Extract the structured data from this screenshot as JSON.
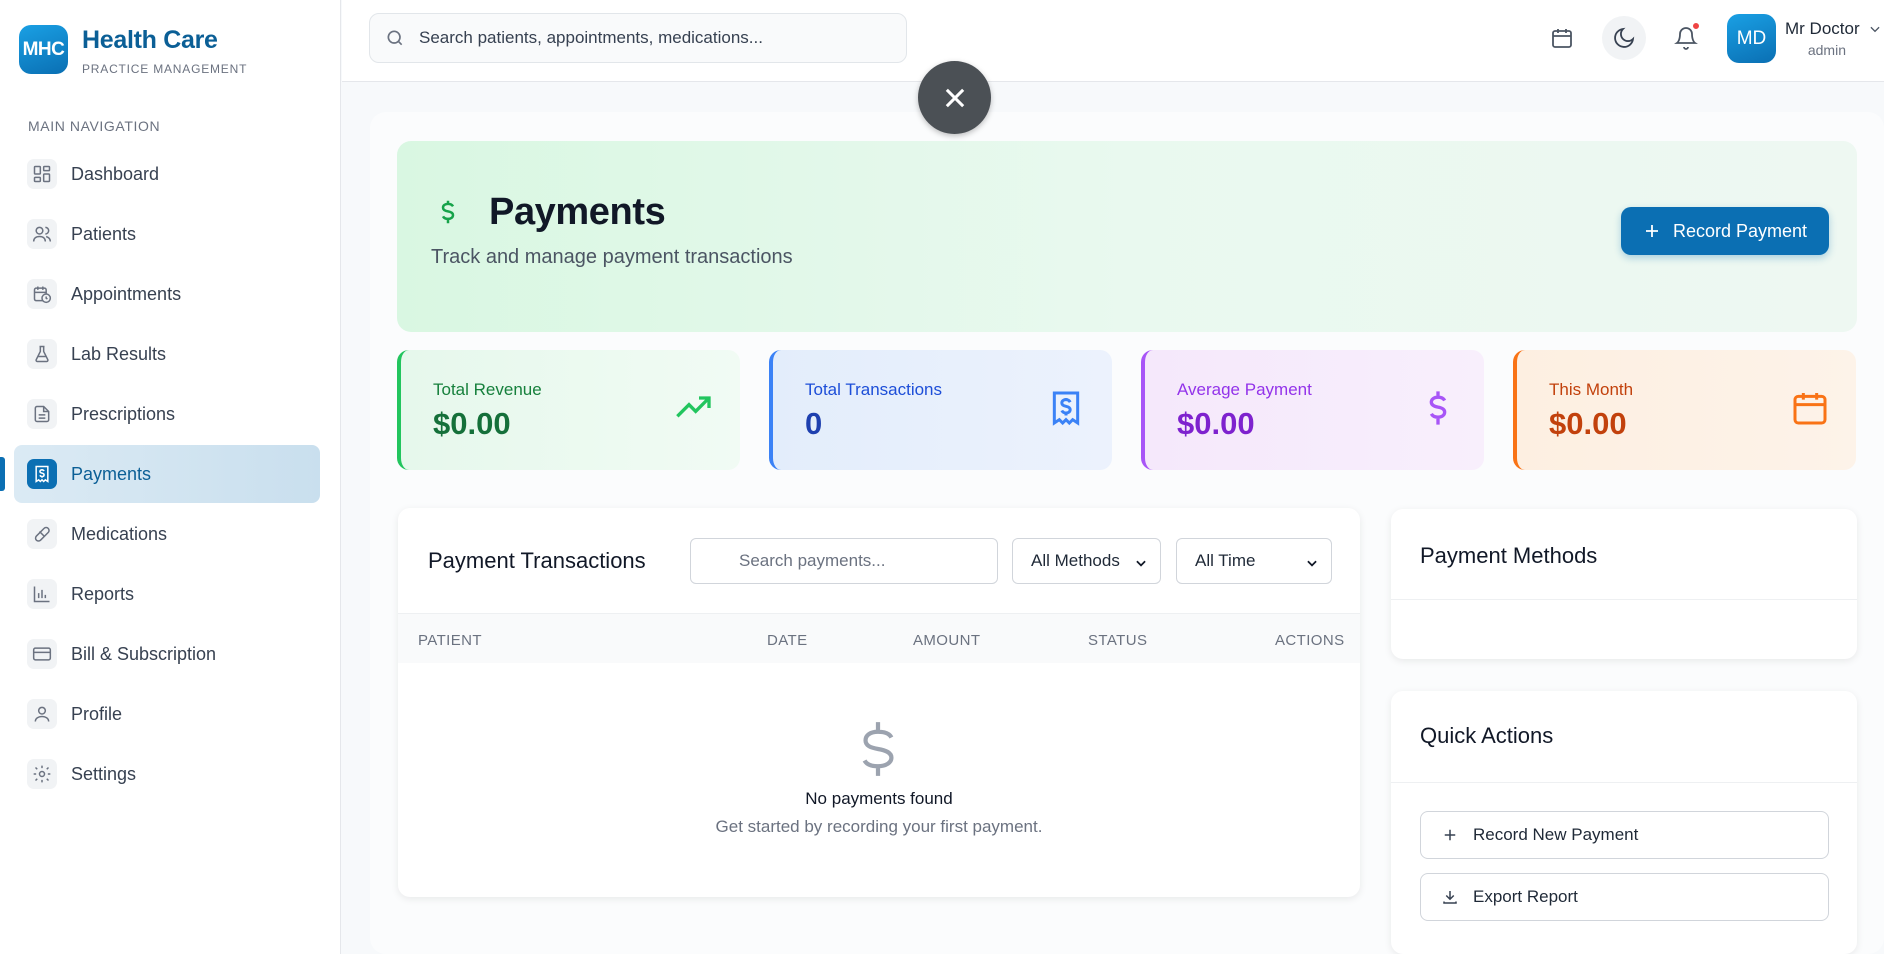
{
  "brand": {
    "logo": "MHC",
    "title": "Health Care",
    "subtitle": "PRACTICE MANAGEMENT"
  },
  "sidebar": {
    "section_label": "MAIN NAVIGATION",
    "items": [
      {
        "label": "Dashboard",
        "icon": "dashboard-icon"
      },
      {
        "label": "Patients",
        "icon": "users-icon"
      },
      {
        "label": "Appointments",
        "icon": "calendar-clock-icon"
      },
      {
        "label": "Lab Results",
        "icon": "flask-icon"
      },
      {
        "label": "Prescriptions",
        "icon": "document-icon"
      },
      {
        "label": "Payments",
        "icon": "receipt-dollar-icon",
        "active": true
      },
      {
        "label": "Medications",
        "icon": "pill-icon"
      },
      {
        "label": "Reports",
        "icon": "bar-chart-icon"
      },
      {
        "label": "Bill & Subscription",
        "icon": "credit-card-icon"
      },
      {
        "label": "Profile",
        "icon": "user-icon"
      },
      {
        "label": "Settings",
        "icon": "gear-icon"
      }
    ]
  },
  "header": {
    "search_placeholder": "Search patients, appointments, medications...",
    "user": {
      "initials": "MD",
      "name": "Mr Doctor",
      "role": "admin"
    }
  },
  "hero": {
    "title": "Payments",
    "subtitle": "Track and manage payment transactions",
    "record_button": "Record Payment"
  },
  "stats": [
    {
      "label": "Total Revenue",
      "value": "$0.00",
      "icon": "trending-up-icon",
      "color": "#22c55e"
    },
    {
      "label": "Total Transactions",
      "value": "0",
      "icon": "receipt-icon",
      "color": "#3b82f6"
    },
    {
      "label": "Average Payment",
      "value": "$0.00",
      "icon": "dollar-icon",
      "color": "#a855f7"
    },
    {
      "label": "This Month",
      "value": "$0.00",
      "icon": "calendar-icon",
      "color": "#f97316"
    }
  ],
  "transactions": {
    "title": "Payment Transactions",
    "search_placeholder": "Search payments...",
    "method_filter": "All Methods",
    "time_filter": "All Time",
    "columns": [
      "PATIENT",
      "DATE",
      "AMOUNT",
      "STATUS",
      "ACTIONS"
    ],
    "empty_title": "No payments found",
    "empty_subtitle": "Get started by recording your first payment."
  },
  "payment_methods": {
    "title": "Payment Methods"
  },
  "quick_actions": {
    "title": "Quick Actions",
    "record_new": "Record New Payment",
    "export": "Export Report"
  },
  "colors": {
    "primary": "#0b6fb3",
    "brand_text": "#0b5f96"
  }
}
